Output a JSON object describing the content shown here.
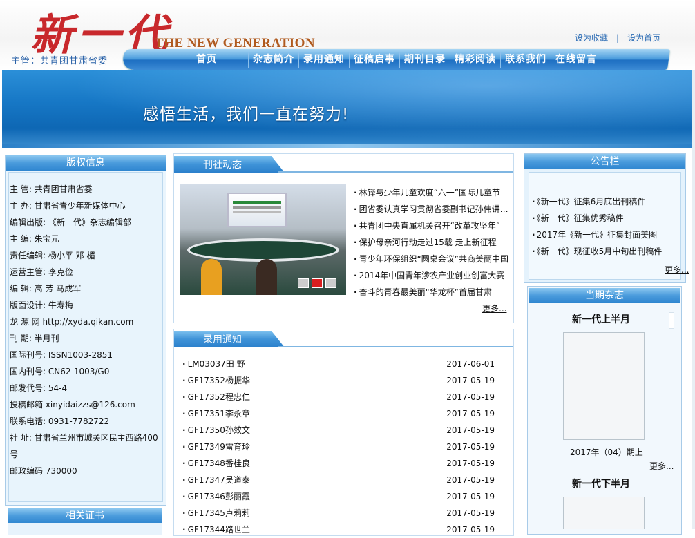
{
  "header": {
    "logo_zh": "新一代",
    "logo_en": "THE NEW GENERATION",
    "sponsor": "主管：共青团甘肃省委",
    "links": [
      "设为收藏",
      "设为首页"
    ],
    "link_separator": "|"
  },
  "nav": {
    "items": [
      "首页",
      "杂志简介",
      "录用通知",
      "征稿启事",
      "期刊目录",
      "精彩阅读",
      "联系我们",
      "在线留言"
    ]
  },
  "banner": {
    "slogan": "感悟生活，我们一直在努力!"
  },
  "copyright": {
    "title": "版权信息",
    "lines": [
      "主 管: 共青团甘肃省委",
      "主 办: 甘肃省青少年新媒体中心",
      "编辑出版: 《新一代》杂志编辑部",
      "主 编: 朱宝元",
      "责任编辑: 杨小平 邓 楣",
      "运营主管: 李克俭",
      "编 辑: 高 芳 马成军",
      "版面设计: 牛寿梅",
      "龙 源 网 http://xyda.qikan.com",
      "刊 期: 半月刊",
      "国际刊号: ISSN1003-2851",
      "国内刊号: CN62-1003/G0",
      "邮发代号: 54-4",
      "投稿邮箱 xinyidaizzs@126.com",
      "联系电话: 0931-7782722",
      "社 址: 甘肃省兰州市城关区民主西路400号",
      "邮政编码 730000"
    ]
  },
  "certificates": {
    "title": "相关证书"
  },
  "news": {
    "title": "刊社动态",
    "items": [
      "林铎与少年儿童欢度“六一”国际儿童节",
      "团省委认真学习贯彻省委副书记孙伟讲话精神",
      "共青团中央直属机关召开“改革攻坚年”",
      "保护母亲河行动走过15载 走上新征程",
      "青少年环保组织“圆桌会议”共商美丽中国",
      "2014年中国青年涉农产业创业创富大赛",
      "奋斗的青春最美丽“华龙杯”首届甘肃"
    ],
    "more": "更多..."
  },
  "notice": {
    "title": "录用通知",
    "rows": [
      {
        "name": "LM03037田 野",
        "date": "2017-06-01"
      },
      {
        "name": "GF17352杨振华",
        "date": "2017-05-19"
      },
      {
        "name": "GF17352程忠仁",
        "date": "2017-05-19"
      },
      {
        "name": "GF17351李永章",
        "date": "2017-05-19"
      },
      {
        "name": "GF17350孙效文",
        "date": "2017-05-19"
      },
      {
        "name": "GF17349雷育玲",
        "date": "2017-05-19"
      },
      {
        "name": "GF17348番桂良",
        "date": "2017-05-19"
      },
      {
        "name": "GF17347吴道泰",
        "date": "2017-05-19"
      },
      {
        "name": "GF17346彭丽霞",
        "date": "2017-05-19"
      },
      {
        "name": "GF17345卢莉莉",
        "date": "2017-05-19"
      },
      {
        "name": "GF17344路世兰",
        "date": "2017-05-19"
      }
    ]
  },
  "board": {
    "title": "公告栏",
    "items": [
      "《新一代》征集6月底出刊稿件",
      "《新一代》征集优秀稿件",
      "2017年《新一代》征集封面美图",
      "《新一代》现征收5月中旬出刊稿件"
    ],
    "more": "更多..."
  },
  "issue": {
    "title": "当期杂志",
    "first_name": "新一代上半月",
    "first_caption": "2017年（04）期上",
    "more": "更多...",
    "second_name": "新一代下半月"
  }
}
